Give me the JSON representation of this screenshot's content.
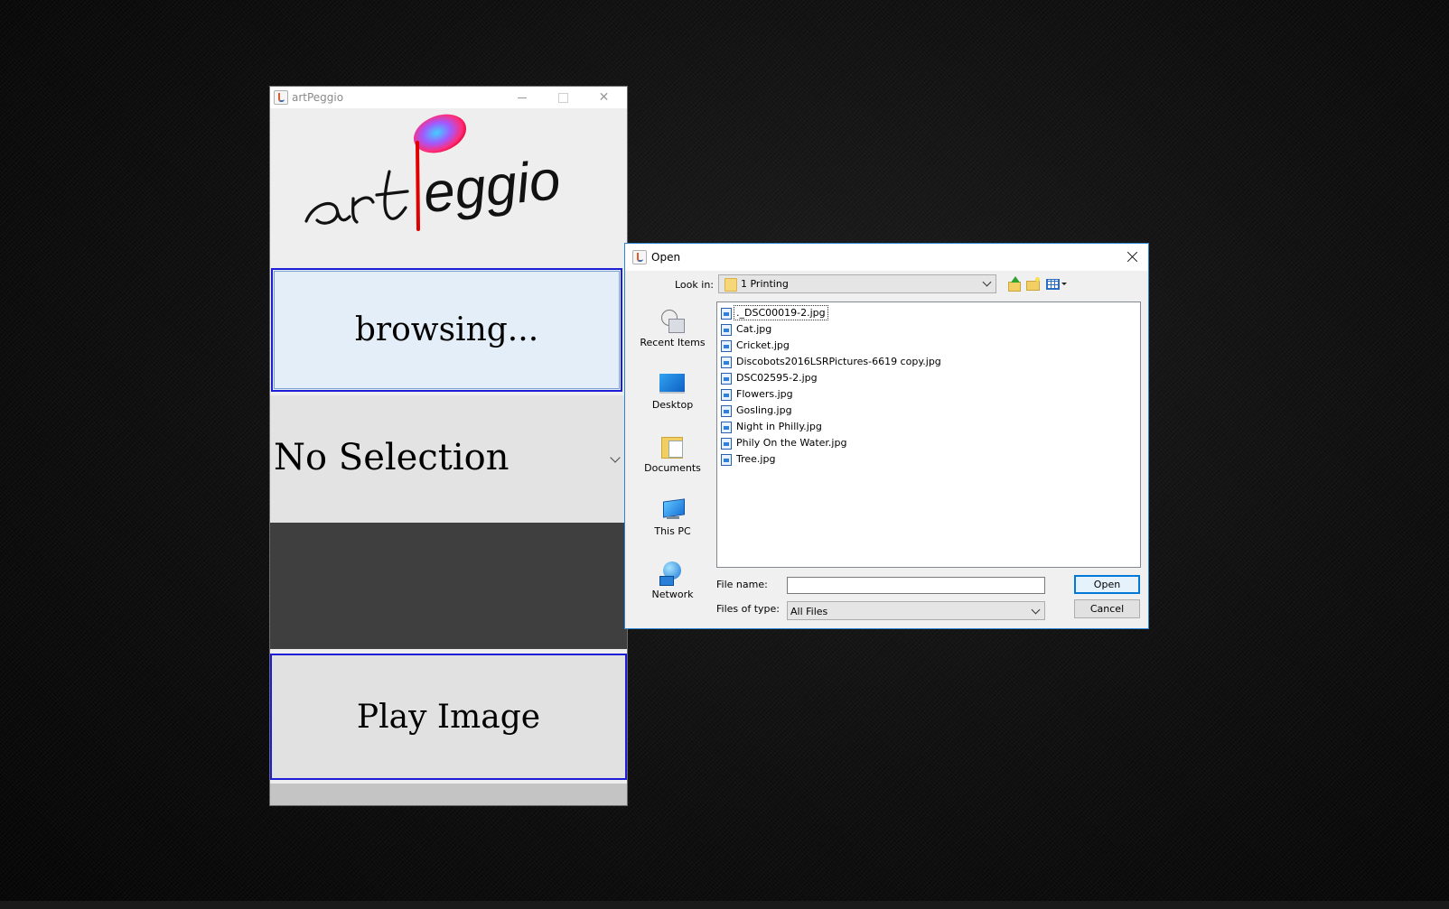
{
  "app": {
    "title": "artPeggio",
    "logo_text": "artPeggio",
    "browse_label": "browsing...",
    "combo_value": "No Selection",
    "play_label": "Play Image"
  },
  "dialog": {
    "title": "Open",
    "look_in_label": "Look in:",
    "look_in_value": "1 Printing",
    "places": [
      "Recent Items",
      "Desktop",
      "Documents",
      "This PC",
      "Network"
    ],
    "files": [
      "._DSC00019-2.jpg",
      "Cat.jpg",
      "Cricket.jpg",
      "Discobots2016LSRPictures-6619 copy.jpg",
      "DSC02595-2.jpg",
      "Flowers.jpg",
      "Gosling.jpg",
      "Night in Philly.jpg",
      "Phily On the Water.jpg",
      "Tree.jpg"
    ],
    "file_name_label": "File name:",
    "file_name_value": "",
    "files_of_type_label": "Files of type:",
    "files_of_type_value": "All Files",
    "open_label": "Open",
    "cancel_label": "Cancel"
  },
  "colors": {
    "desktop_bg": "#111111",
    "focus_border": "#1e1ed8",
    "dialog_accent": "#0078d7"
  }
}
